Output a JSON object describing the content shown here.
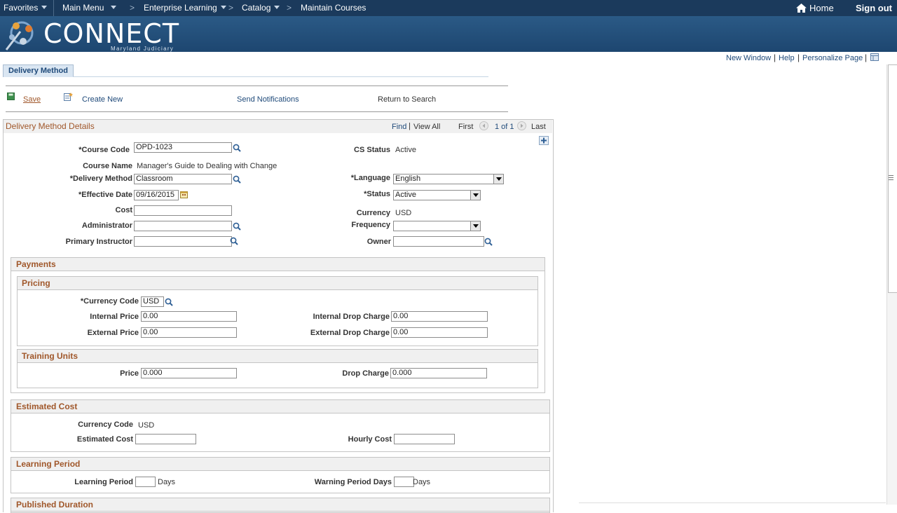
{
  "topnav": {
    "favorites": "Favorites",
    "main_menu": "Main Menu",
    "enterprise_learning": "Enterprise Learning",
    "catalog": "Catalog",
    "maintain_courses": "Maintain Courses",
    "home": "Home",
    "sign_out": "Sign out"
  },
  "banner": {
    "logo_text": "CONNECT",
    "logo_sub": "Maryland Judiciary"
  },
  "pagelinks": {
    "new_window": "New Window",
    "help": "Help",
    "personalize": "Personalize Page"
  },
  "tab": {
    "label": "Delivery Method"
  },
  "toolbar": {
    "save": "Save",
    "create_new": "Create New",
    "send_notifications": "Send Notifications",
    "return_to_search": "Return to Search"
  },
  "details": {
    "title": "Delivery Method Details",
    "find": "Find",
    "view_all": "View All",
    "first": "First",
    "count": "1 of 1",
    "last": "Last",
    "course_code_label": "*Course Code",
    "course_code_value": "OPD-1023",
    "cs_status_label": "CS Status",
    "cs_status_value": "Active",
    "course_name_label": "Course Name",
    "course_name_value": "Manager's Guide to Dealing with Change",
    "delivery_method_label": "*Delivery Method",
    "delivery_method_value": "Classroom",
    "language_label": "*Language",
    "language_value": "English",
    "effective_date_label": "*Effective Date",
    "effective_date_value": "09/16/2015",
    "status_label": "*Status",
    "status_value": "Active",
    "cost_label": "Cost",
    "cost_value": "",
    "currency_label": "Currency",
    "currency_value": "USD",
    "administrator_label": "Administrator",
    "administrator_value": "",
    "frequency_label": "Frequency",
    "frequency_value": "",
    "primary_instructor_label": "Primary Instructor",
    "primary_instructor_value": "",
    "owner_label": "Owner",
    "owner_value": ""
  },
  "payments": {
    "title": "Payments",
    "pricing": {
      "title": "Pricing",
      "currency_code_label": "*Currency Code",
      "currency_code_value": "USD",
      "internal_price_label": "Internal Price",
      "internal_price_value": "0.00",
      "internal_drop_label": "Internal Drop Charge",
      "internal_drop_value": "0.00",
      "external_price_label": "External Price",
      "external_price_value": "0.00",
      "external_drop_label": "External Drop Charge",
      "external_drop_value": "0.00"
    },
    "training_units": {
      "title": "Training Units",
      "price_label": "Price",
      "price_value": "0.000",
      "drop_label": "Drop Charge",
      "drop_value": "0.000"
    }
  },
  "estimated_cost": {
    "title": "Estimated Cost",
    "currency_code_label": "Currency Code",
    "currency_code_value": "USD",
    "estimated_cost_label": "Estimated Cost",
    "estimated_cost_value": "",
    "hourly_cost_label": "Hourly Cost",
    "hourly_cost_value": ""
  },
  "learning_period": {
    "title": "Learning Period",
    "learning_period_label": "Learning Period",
    "learning_period_value": "",
    "days1": "Days",
    "warning_label": "Warning Period Days",
    "warning_value": "",
    "days2": "Days"
  },
  "published_duration": {
    "title": "Published Duration"
  },
  "colors": {
    "nav_bg": "#1b3a5c",
    "banner_bg": "#2b5a86",
    "section_title": "#a0572a",
    "link": "#1f4a7a"
  }
}
